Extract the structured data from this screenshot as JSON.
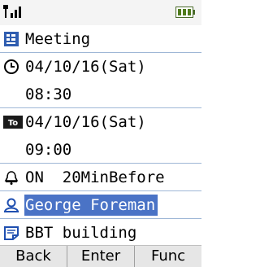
{
  "status": {
    "signal_icon": "signal-icon",
    "battery_icon": "battery-icon"
  },
  "event": {
    "title": "Meeting",
    "start_date": "04/10/16(Sat)",
    "start_time": "08:30",
    "end_date": "04/10/16(Sat)",
    "end_time": "09:00",
    "alarm": "ON  20MinBefore",
    "contact": "George Foreman",
    "location": "BBT building"
  },
  "softkeys": {
    "back": "Back",
    "enter": "Enter",
    "func": "Func"
  },
  "colors": {
    "highlight": "#4a73c6",
    "divider": "#9fb7d6"
  }
}
